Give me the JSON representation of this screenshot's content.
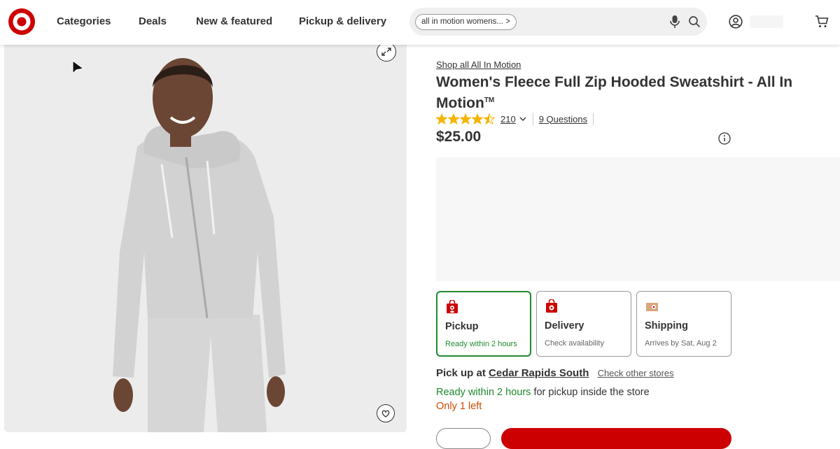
{
  "header": {
    "nav": [
      "Categories",
      "Deals",
      "New & featured",
      "Pickup & delivery"
    ],
    "search_chip": "all in motion womens... >"
  },
  "product": {
    "brand_link": "Shop all All In Motion",
    "title": "Women's Fleece Full Zip Hooded Sweatshirt - All In Motion",
    "trademark": "TM",
    "rating": 4.5,
    "review_count": "210",
    "questions": "9 Questions",
    "price": "$25.00"
  },
  "fulfillment": [
    {
      "title": "Pickup",
      "subtitle": "Ready within 2 hours",
      "selected": true
    },
    {
      "title": "Delivery",
      "subtitle": "Check availability",
      "selected": false
    },
    {
      "title": "Shipping",
      "subtitle": "Arrives by Sat, Aug 2",
      "selected": false
    }
  ],
  "pickup": {
    "prefix": "Pick up at",
    "store": "Cedar Rapids South",
    "check_other": "Check other stores",
    "ready": "Ready within 2 hours",
    "ready_suffix": "for pickup inside the store",
    "stock": "Only 1 left"
  },
  "colors": {
    "brand_red": "#cc0000",
    "success_green": "#1f8a2e",
    "stock_orange": "#cc4b00",
    "star_gold": "#f5b400"
  },
  "icons": [
    "target-logo-icon",
    "mic-icon",
    "search-icon",
    "account-icon",
    "cart-icon",
    "expand-icon",
    "heart-icon",
    "info-icon",
    "chevron-down-icon",
    "store-bag-icon",
    "delivery-bag-icon",
    "shipping-box-icon",
    "cursor-icon"
  ]
}
